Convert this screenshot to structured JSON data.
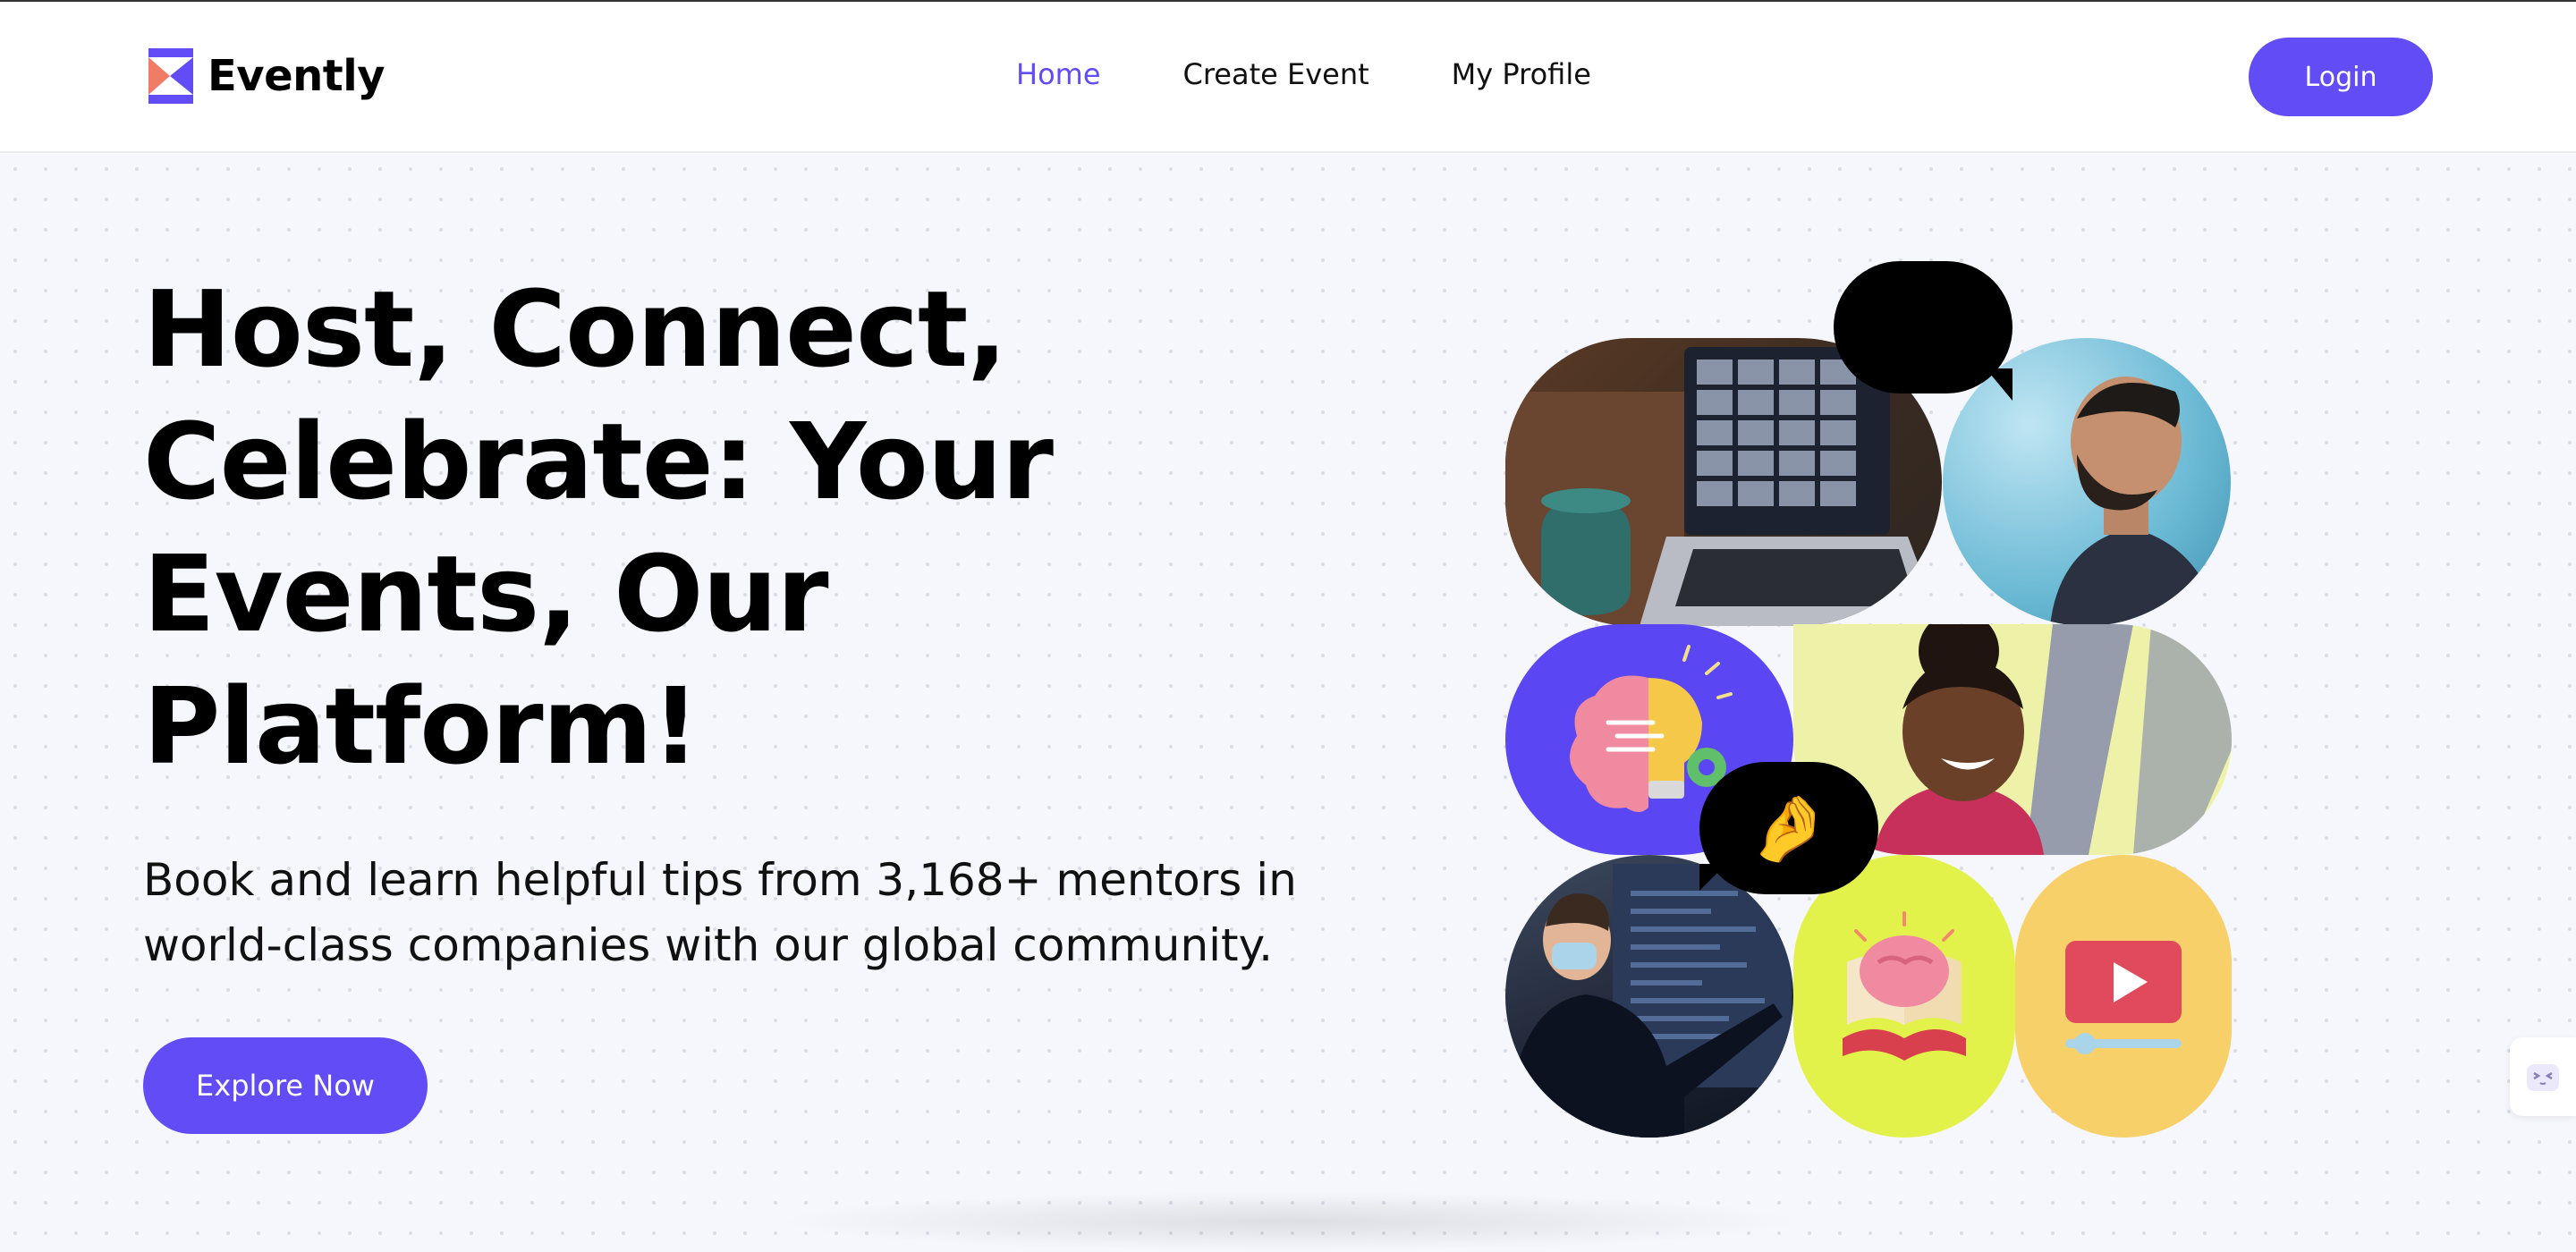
{
  "header": {
    "brand": "Evently",
    "nav": [
      {
        "label": "Home",
        "active": true
      },
      {
        "label": "Create Event",
        "active": false
      },
      {
        "label": "My Profile",
        "active": false
      }
    ],
    "login_label": "Login"
  },
  "hero": {
    "headline": "Host, Connect, Celebrate: Your Events, Our Platform!",
    "subtitle": "Book and learn helpful tips from 3,168+ mentors in world-class companies with our global community.",
    "cta_label": "Explore Now"
  },
  "collage": {
    "emoji_love": "😍",
    "emoji_pinch": "🤌"
  },
  "colors": {
    "accent": "#624cf5",
    "hero_bg": "#f6f7fc",
    "yellow_green": "#e3f24b",
    "yellow": "#f7d06a"
  }
}
